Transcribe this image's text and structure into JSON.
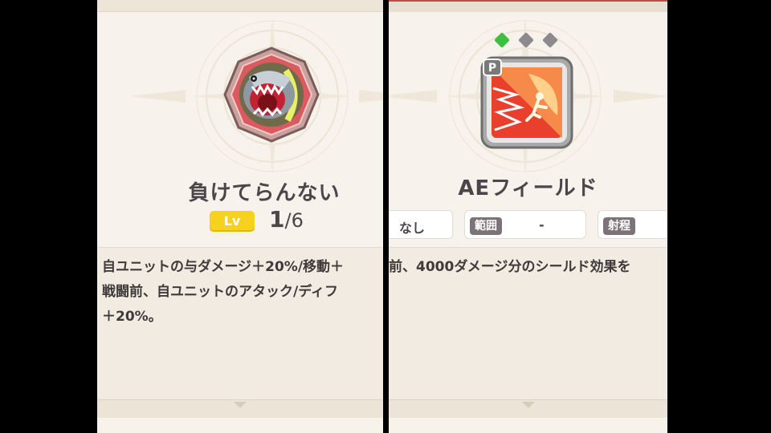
{
  "left_panel": {
    "title": "負けてらんない",
    "level_label": "Lv",
    "level_current": "1",
    "level_max": "/6",
    "description": [
      "自ユニットの与ダメージ＋20%/移動＋",
      "戦闘前、自ユニットのアタック/ディフ",
      "＋20%。"
    ]
  },
  "right_panel": {
    "title": "AEフィールド",
    "gems": {
      "active": 1,
      "total": 3
    },
    "stats": [
      {
        "label": "",
        "value": "なし"
      },
      {
        "label": "範囲",
        "value": "-"
      },
      {
        "label": "射程",
        "value": ""
      }
    ],
    "description": [
      "前、4000ダメージ分のシールド効果を"
    ],
    "skill_badge": "P"
  },
  "colors": {
    "gem_active": "#3fbf3f",
    "gem_inactive": "#8c8a8c",
    "level_badge": "#f6d21f",
    "stat_tag": "#7b7377"
  }
}
